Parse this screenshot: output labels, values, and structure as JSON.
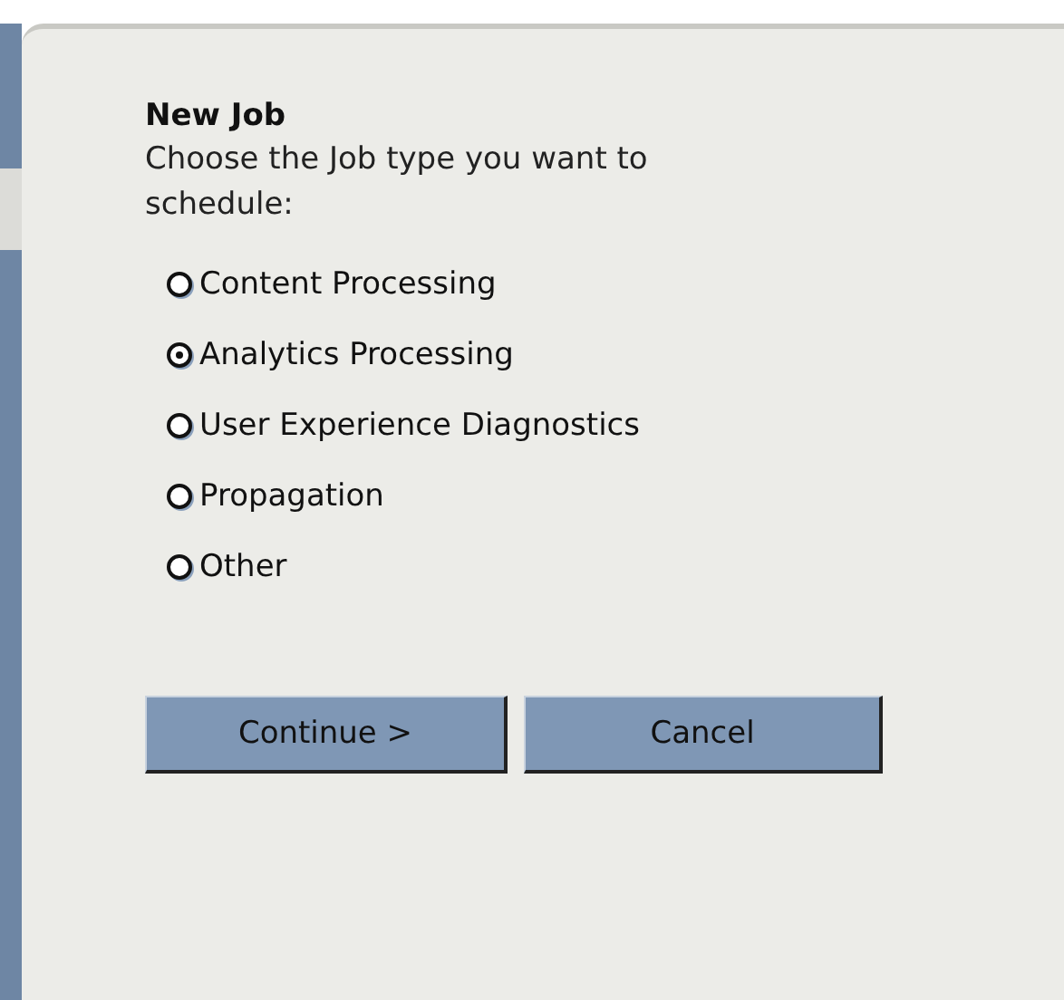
{
  "dialog": {
    "title": "New Job",
    "description": "Choose the Job type you want to schedule:",
    "options": [
      {
        "label": "Content Processing",
        "selected": false
      },
      {
        "label": "Analytics Processing",
        "selected": true
      },
      {
        "label": "User Experience Diagnostics",
        "selected": false
      },
      {
        "label": "Propagation",
        "selected": false
      },
      {
        "label": "Other",
        "selected": false
      }
    ],
    "buttons": [
      "Continue >",
      "Cancel"
    ]
  }
}
